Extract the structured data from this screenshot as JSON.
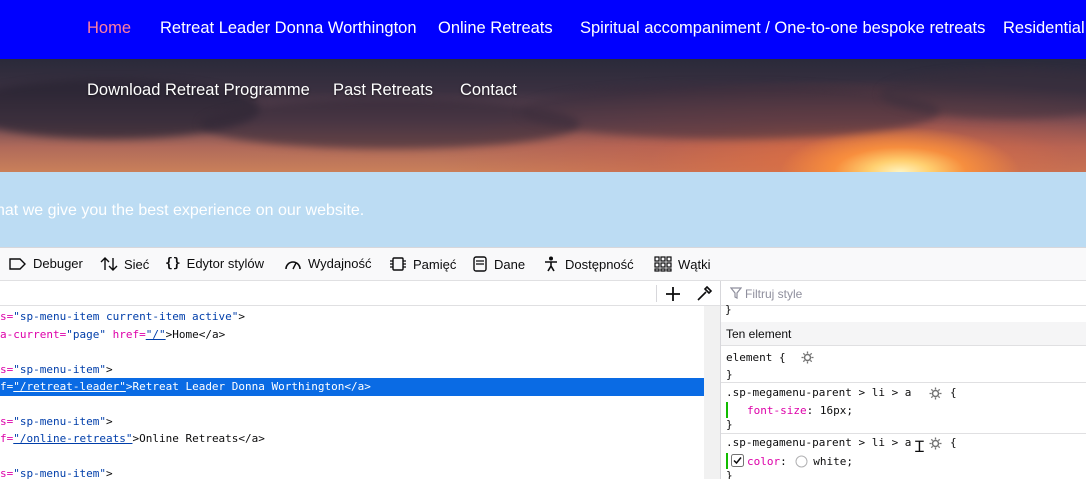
{
  "site": {
    "nav": {
      "items": [
        {
          "label": "Home",
          "active": true
        },
        {
          "label": "Retreat Leader Donna Worthington"
        },
        {
          "label": "Online Retreats"
        },
        {
          "label": "Spiritual accompaniment / One-to-one bespoke retreats"
        },
        {
          "label": "Residential"
        }
      ],
      "sub_items": [
        {
          "label": "Download Retreat Programme"
        },
        {
          "label": "Past Retreats"
        },
        {
          "label": "Contact"
        }
      ],
      "bg_color": "#0000ff",
      "active_color": "#ff7fa0"
    },
    "cookie_text": "hat we give you the best experience on our website."
  },
  "devtools": {
    "tabs": [
      {
        "label": "Debuger",
        "icon": "debugger-icon"
      },
      {
        "label": "Sieć",
        "icon": "network-icon"
      },
      {
        "label": "Edytor stylów",
        "icon": "style-editor-icon"
      },
      {
        "label": "Wydajność",
        "icon": "performance-icon"
      },
      {
        "label": "Pamięć",
        "icon": "memory-icon"
      },
      {
        "label": "Dane",
        "icon": "storage-icon"
      },
      {
        "label": "Dostępność",
        "icon": "accessibility-icon"
      },
      {
        "label": "Wątki",
        "icon": "threads-icon"
      }
    ],
    "markup": {
      "lines": [
        {
          "attr": "s=",
          "val": "\"sp-menu-item current-item active\"",
          "tail": ">"
        },
        {
          "attr": "a-current=",
          "val": "\"page\"",
          "mid": " href=",
          "link": "\"/\"",
          "tail": ">Home</a>"
        },
        {
          "attr": "",
          "val": "",
          "tail": ""
        },
        {
          "attr": "s=",
          "val": "\"sp-menu-item\"",
          "tail": ">"
        },
        {
          "attr": "f=",
          "val": "",
          "link": "\"/retreat-leader\"",
          "tail": ">Retreat Leader Donna Worthington</a>",
          "selected": true
        },
        {
          "attr": "",
          "val": "",
          "tail": ""
        },
        {
          "attr": "s=",
          "val": "\"sp-menu-item\"",
          "tail": ">"
        },
        {
          "attr": "f=",
          "val": "",
          "link": "\"/online-retreats\"",
          "tail": ">Online Retreats</a>"
        },
        {
          "attr": "",
          "val": "",
          "tail": ""
        },
        {
          "attr": "s=",
          "val": "\"sp-menu-item\"",
          "tail": ">"
        }
      ]
    },
    "rules": {
      "filter_placeholder": "Filtruj style",
      "top_brace": "}",
      "section_title": "Ten element",
      "element_rule": "element {",
      "close_brace": "}",
      "rule1_selector": ".sp-megamenu-parent > li > a",
      "rule1_open": "{",
      "rule1_prop": "font-size",
      "rule1_value": "16px;",
      "rule2_selector": ".sp-megamenu-parent > li > a",
      "rule2_open": "{",
      "rule2_prop": "color",
      "rule2_value": "white;",
      "colon": ":"
    }
  }
}
